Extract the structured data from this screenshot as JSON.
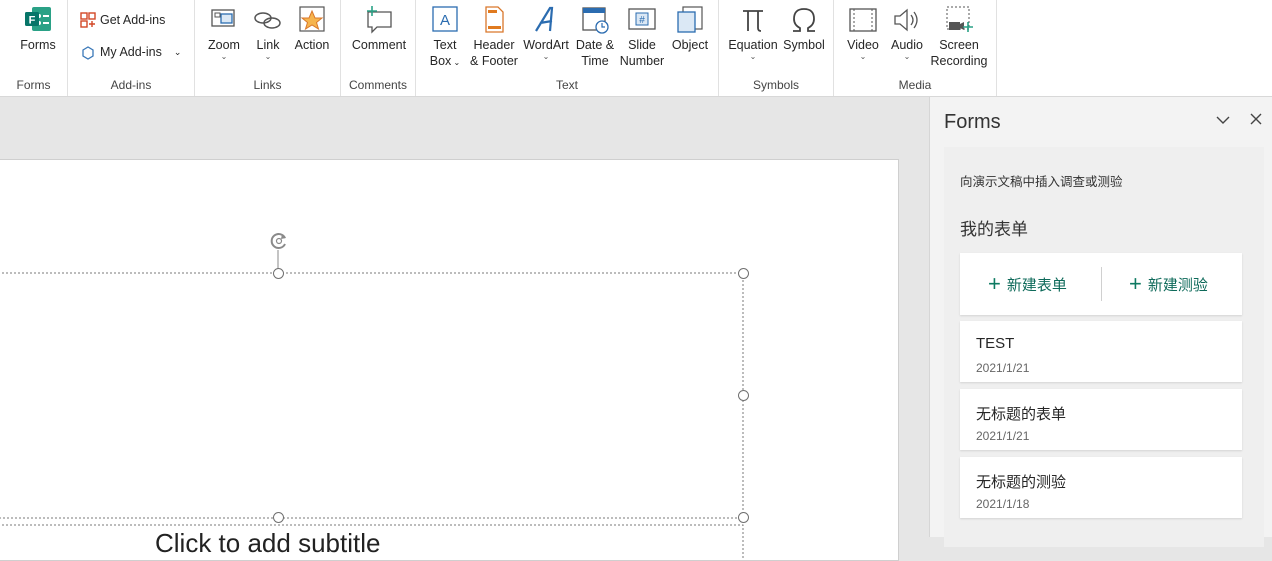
{
  "ribbon": {
    "forms": {
      "label": "Forms",
      "group": "Forms"
    },
    "addins": {
      "get": "Get Add-ins",
      "my": "My Add-ins",
      "group": "Add-ins"
    },
    "links": {
      "zoom": "Zoom",
      "link": "Link",
      "action": "Action",
      "group": "Links"
    },
    "comments": {
      "comment": "Comment",
      "group": "Comments"
    },
    "text": {
      "textbox1": "Text",
      "textbox2": "Box",
      "header1": "Header",
      "header2": "& Footer",
      "wordart": "WordArt",
      "date1": "Date &",
      "date2": "Time",
      "slide1": "Slide",
      "slide2": "Number",
      "object": "Object",
      "group": "Text"
    },
    "symbols": {
      "equation": "Equation",
      "symbol": "Symbol",
      "group": "Symbols"
    },
    "media": {
      "video": "Video",
      "audio": "Audio",
      "screen1": "Screen",
      "screen2": "Recording",
      "group": "Media"
    }
  },
  "slide": {
    "placeholder_text": "Click to add subtitle"
  },
  "pane": {
    "title": "Forms",
    "description": "向演示文稿中插入调查或测验",
    "section_title": "我的表单",
    "new_form": "新建表单",
    "new_quiz": "新建测验",
    "items": [
      {
        "title": "TEST",
        "date": "2021/1/21"
      },
      {
        "title": "无标题的表单",
        "date": "2021/1/21"
      },
      {
        "title": "无标题的测验",
        "date": "2021/1/18"
      }
    ]
  },
  "colors": {
    "accent_green": "#0e7a62",
    "icon_blue": "#2b6cb0",
    "icon_orange": "#e07a1f"
  }
}
